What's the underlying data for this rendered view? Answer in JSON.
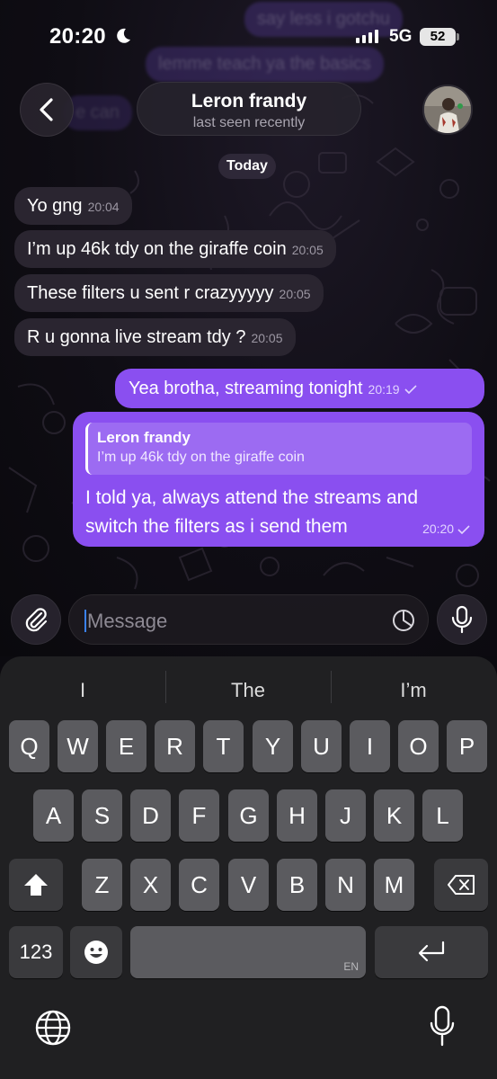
{
  "status_bar": {
    "time": "20:20",
    "network": "5G",
    "battery": "52"
  },
  "ghost_messages": [
    "say less i gotchu",
    "lemme teach ya the basics",
    "e can"
  ],
  "header": {
    "contact_name": "Leron frandy",
    "contact_status": "last seen recently"
  },
  "date_chip": "Today",
  "messages": [
    {
      "direction": "in",
      "text": "Yo gng",
      "time": "20:04"
    },
    {
      "direction": "in",
      "text": "I’m up 46k tdy on the giraffe coin",
      "time": "20:05"
    },
    {
      "direction": "in",
      "text": "These filters u sent r crazyyyyy",
      "time": "20:05"
    },
    {
      "direction": "in",
      "text": "R u gonna live stream tdy ?",
      "time": "20:05"
    },
    {
      "direction": "out",
      "text": "Yea brotha, streaming tonight",
      "time": "20:19"
    },
    {
      "direction": "out",
      "reply_to": {
        "name": "Leron frandy",
        "text": "I’m up 46k tdy on the giraffe coin"
      },
      "text": "I told ya, always attend the streams and switch the filters as i send them",
      "time": "20:20"
    }
  ],
  "composer": {
    "placeholder": "Message"
  },
  "keyboard": {
    "suggestions": [
      "I",
      "The",
      "I’m"
    ],
    "row1": [
      "Q",
      "W",
      "E",
      "R",
      "T",
      "Y",
      "U",
      "I",
      "O",
      "P"
    ],
    "row2": [
      "A",
      "S",
      "D",
      "F",
      "G",
      "H",
      "J",
      "K",
      "L"
    ],
    "row3": [
      "Z",
      "X",
      "C",
      "V",
      "B",
      "N",
      "M"
    ],
    "numbers_key": "123",
    "space_lang": "EN"
  },
  "colors": {
    "outgoing_bubble": "#8a4ff0",
    "incoming_bubble": "#2a2530",
    "caret": "#3a82f6"
  }
}
